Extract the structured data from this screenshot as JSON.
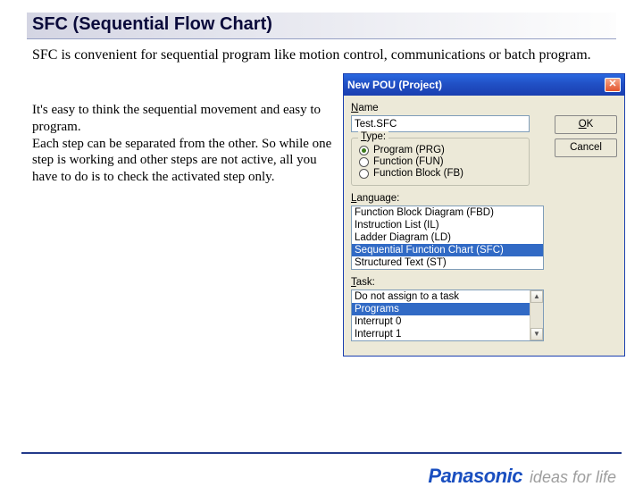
{
  "slide": {
    "title": "SFC (Sequential Flow Chart)",
    "intro": "SFC is convenient for sequential program like motion control, communications or batch program.",
    "explain": "It's easy to think the sequential movement and easy to program.\nEach step can be separated from the other. So while one step is working and other steps are not active, all you have to do is to check the activated step only."
  },
  "dialog": {
    "title": "New POU (Project)",
    "close_glyph": "✕",
    "name_label_pre": "N",
    "name_label_post": "ame",
    "name_value": "Test.SFC",
    "ok_pre": "O",
    "ok_post": "K",
    "cancel_label": "Cancel",
    "type_legend_pre": "T",
    "type_legend_post": "ype:",
    "type_options": [
      {
        "label": "Program (PRG)",
        "checked": true
      },
      {
        "label": "Function (FUN)",
        "checked": false
      },
      {
        "label": "Function Block (FB)",
        "checked": false
      }
    ],
    "lang_label_pre": "L",
    "lang_label_post": "anguage:",
    "lang_options": [
      {
        "label": "Function Block Diagram (FBD)",
        "selected": false
      },
      {
        "label": "Instruction List (IL)",
        "selected": false
      },
      {
        "label": "Ladder Diagram (LD)",
        "selected": false
      },
      {
        "label": "Sequential Function Chart (SFC)",
        "selected": true
      },
      {
        "label": "Structured Text (ST)",
        "selected": false
      }
    ],
    "task_label_pre": "T",
    "task_label_post": "ask:",
    "task_options": [
      {
        "label": "Do not assign to a task",
        "selected": false
      },
      {
        "label": "Programs",
        "selected": true
      },
      {
        "label": "Interrupt 0",
        "selected": false
      },
      {
        "label": "Interrupt 1",
        "selected": false
      }
    ],
    "scroll_up": "▲",
    "scroll_down": "▼"
  },
  "footer": {
    "brand": "Panasonic",
    "tagline": "ideas for life"
  }
}
